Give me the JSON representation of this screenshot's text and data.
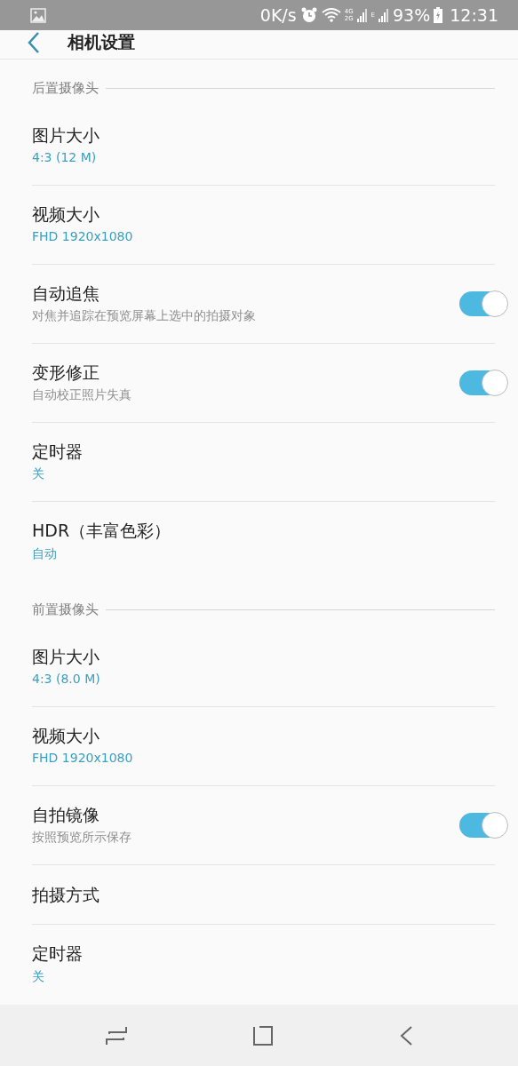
{
  "status_bar": {
    "speed": "0K/s",
    "network_labels": [
      "4G",
      "2G",
      "E"
    ],
    "battery": "93%",
    "time": "12:31"
  },
  "header": {
    "title": "相机设置"
  },
  "sections": [
    {
      "title": "后置摄像头",
      "items": [
        {
          "kind": "value",
          "title": "图片大小",
          "value": "4:3 (12 M)"
        },
        {
          "kind": "value",
          "title": "视频大小",
          "value": "FHD 1920x1080"
        },
        {
          "kind": "toggle",
          "title": "自动追焦",
          "subtitle": "对焦并追踪在预览屏幕上选中的拍摄对象",
          "on": true
        },
        {
          "kind": "toggle",
          "title": "变形修正",
          "subtitle": "自动校正照片失真",
          "on": true
        },
        {
          "kind": "value",
          "title": "定时器",
          "value": "关"
        },
        {
          "kind": "value",
          "title": "HDR（丰富色彩）",
          "value": "自动"
        }
      ]
    },
    {
      "title": "前置摄像头",
      "items": [
        {
          "kind": "value",
          "title": "图片大小",
          "value": "4:3 (8.0 M)"
        },
        {
          "kind": "value",
          "title": "视频大小",
          "value": "FHD 1920x1080"
        },
        {
          "kind": "toggle",
          "title": "自拍镜像",
          "subtitle": "按照预览所示保存",
          "on": true
        },
        {
          "kind": "plain",
          "title": "拍摄方式"
        },
        {
          "kind": "value",
          "title": "定时器",
          "value": "关"
        }
      ]
    }
  ]
}
